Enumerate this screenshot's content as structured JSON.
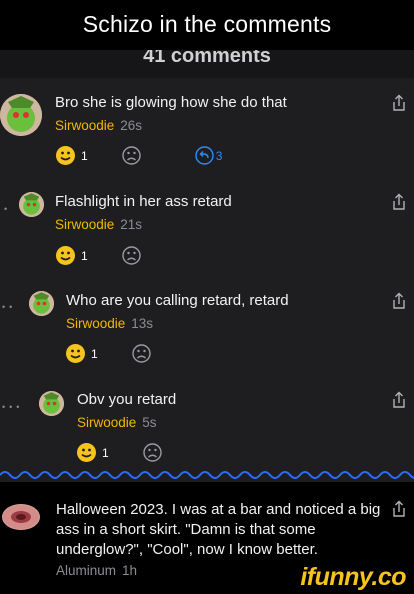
{
  "banner": {
    "title": "Schizo in the comments"
  },
  "comments_header": {
    "count_label": "41 comments"
  },
  "comments": [
    {
      "text": "Bro she is glowing how she do that",
      "user": "Sirwoodie",
      "time": "26s",
      "smile_count": "1",
      "reply_count": "3"
    },
    {
      "text": "Flashlight in her ass retard",
      "user": "Sirwoodie",
      "time": "21s",
      "smile_count": "1"
    },
    {
      "text": "Who are you calling retard, retard",
      "user": "Sirwoodie",
      "time": "13s",
      "smile_count": "1"
    },
    {
      "text": "Obv you retard",
      "user": "Sirwoodie",
      "time": "5s",
      "smile_count": "1"
    }
  ],
  "post": {
    "text": "Halloween 2023. I was at a bar and noticed a big ass in a short skirt. \"Damn is that some underglow?\", \"Cool\", now I know better.",
    "user": "Aluminum",
    "time": "1h"
  },
  "watermark": {
    "text": "ifunny.co"
  },
  "colors": {
    "username": "#f5b800",
    "smile": "#f7c31d",
    "reply": "#2b8cff",
    "background": "#1e1e20"
  },
  "icons": [
    "share-icon",
    "smile-icon",
    "frown-icon",
    "reply-icon",
    "avatar"
  ]
}
